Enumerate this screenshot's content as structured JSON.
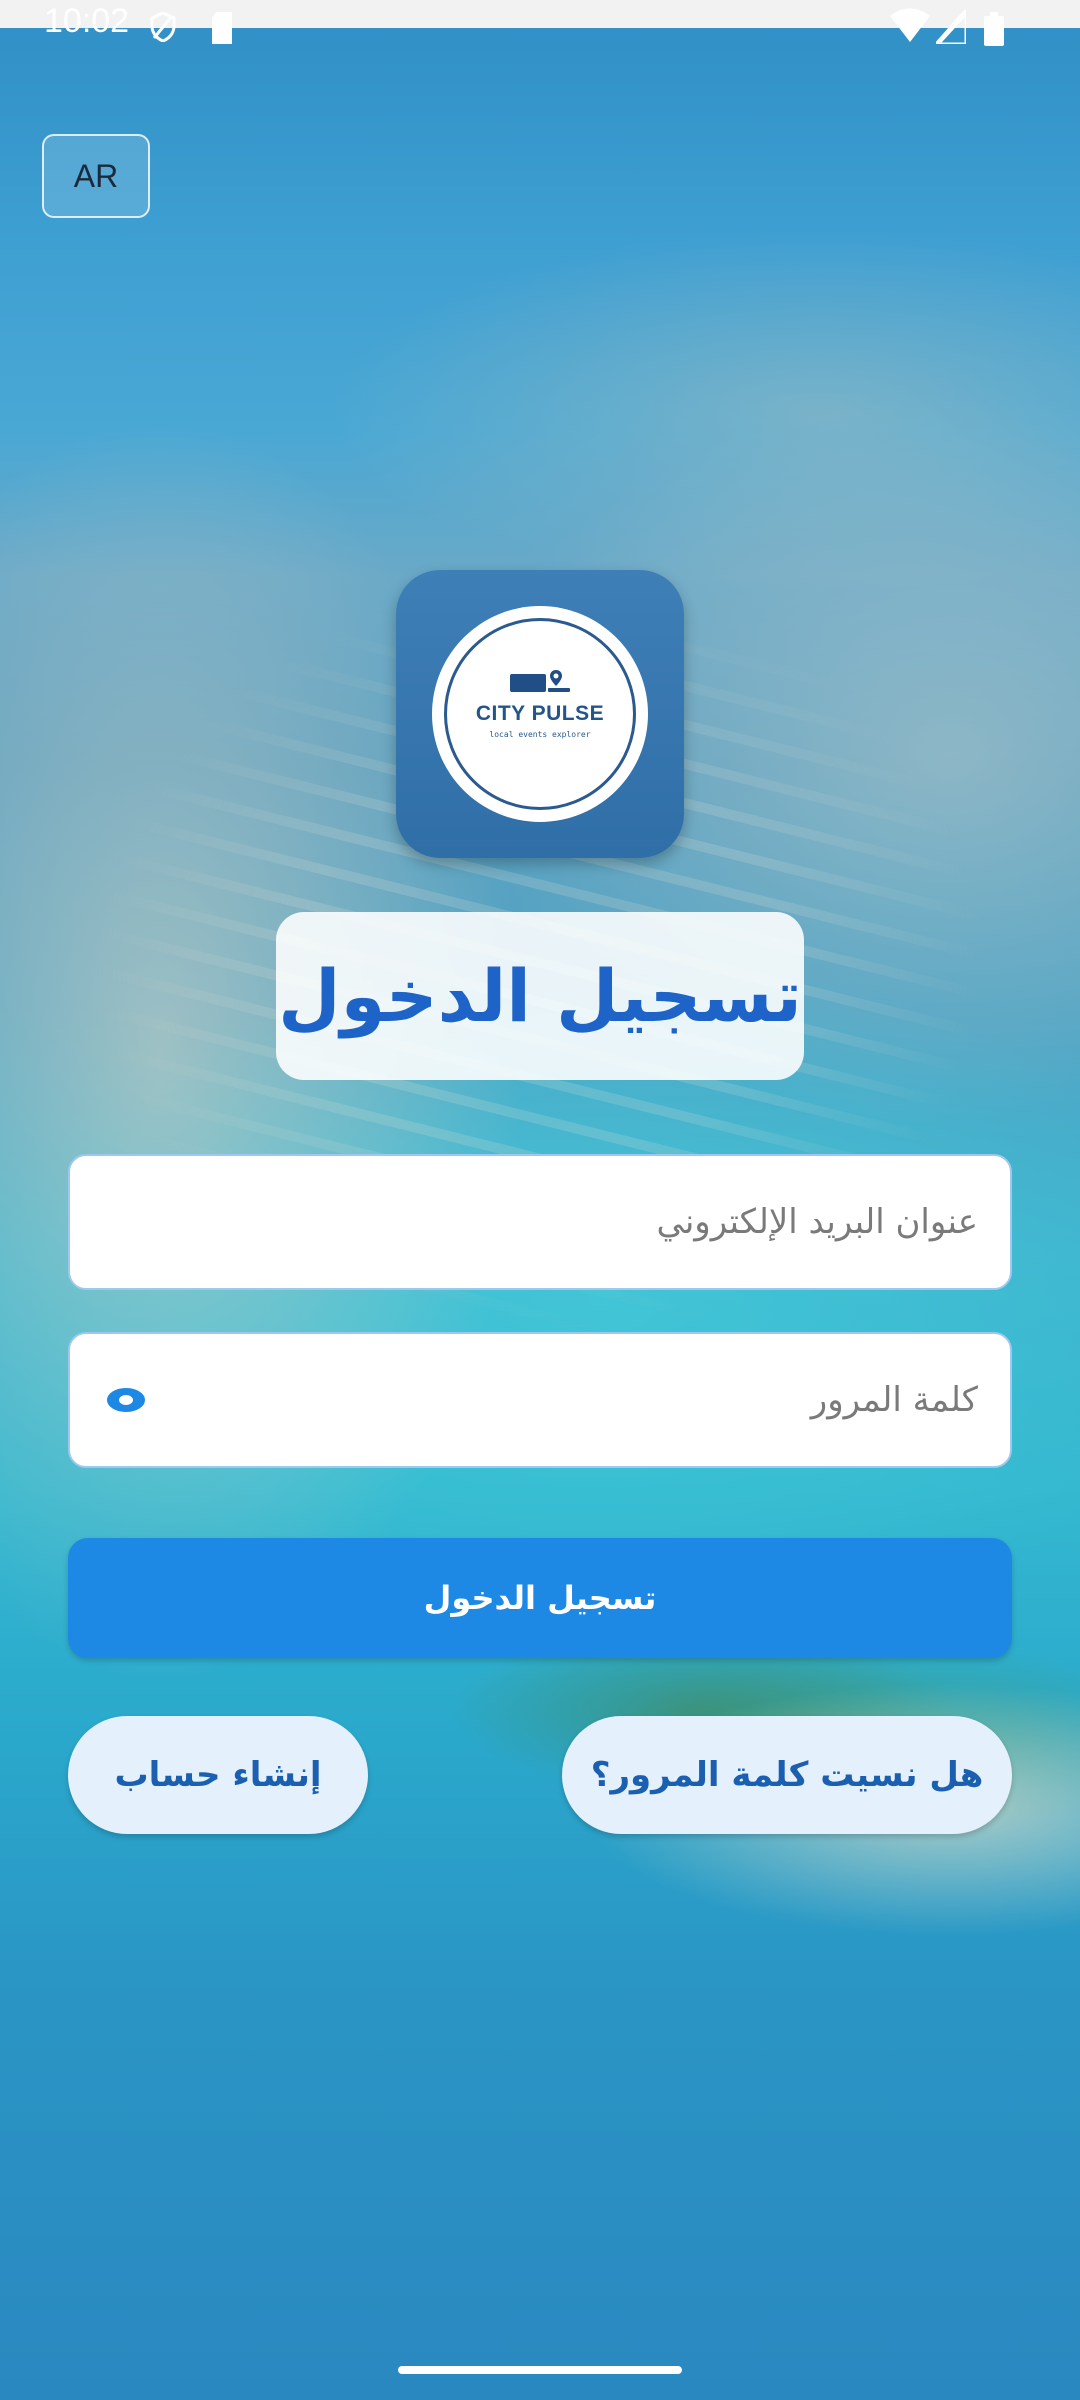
{
  "status_bar": {
    "time": "10:02"
  },
  "language": {
    "label": "AR"
  },
  "logo": {
    "name": "CITY PULSE",
    "tagline": "local events explorer"
  },
  "login": {
    "title": "تسجيل الدخول",
    "email_placeholder": "عنوان البريد الإلكتروني",
    "password_placeholder": "كلمة المرور",
    "submit_label": "تسجيل الدخول",
    "forgot_label": "هل نسيت كلمة المرور؟",
    "create_label": "إنشاء حساب"
  },
  "colors": {
    "primary": "#1e88e5",
    "title": "#1e63c7",
    "pill_bg": "#e4f0fb",
    "logo_bg": "#3f7fb7"
  }
}
